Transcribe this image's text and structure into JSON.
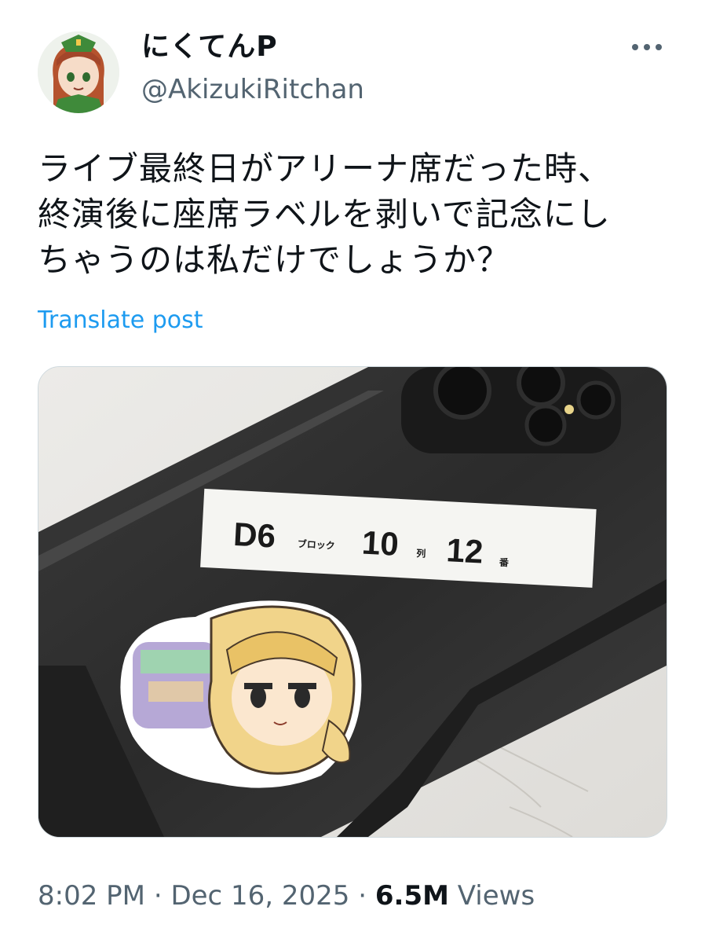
{
  "post": {
    "author": {
      "display_name": "にくてんP",
      "handle": "@AkizukiRitchan",
      "avatar_icon": "anime-character-avatar"
    },
    "more_icon": "more-options-icon",
    "text_lines": [
      "ライブ最終日がアリーナ席だった時、",
      "終演後に座席ラベルを剥いで記念にし",
      "ちゃうのは私だけでしょうか？"
    ],
    "translate_label": "Translate post",
    "media": {
      "seat_label": {
        "block": "D6",
        "block_unit": "ブロック",
        "row": "10",
        "row_unit": "列",
        "seat": "12",
        "seat_unit": "番"
      }
    },
    "meta": {
      "time": "8:02 PM",
      "separator": "·",
      "date": "Dec 16, 2025",
      "views_count": "6.5M",
      "views_label": "Views"
    }
  },
  "colors": {
    "text_primary": "#0f1419",
    "text_secondary": "#536471",
    "link": "#1d9bf0"
  }
}
